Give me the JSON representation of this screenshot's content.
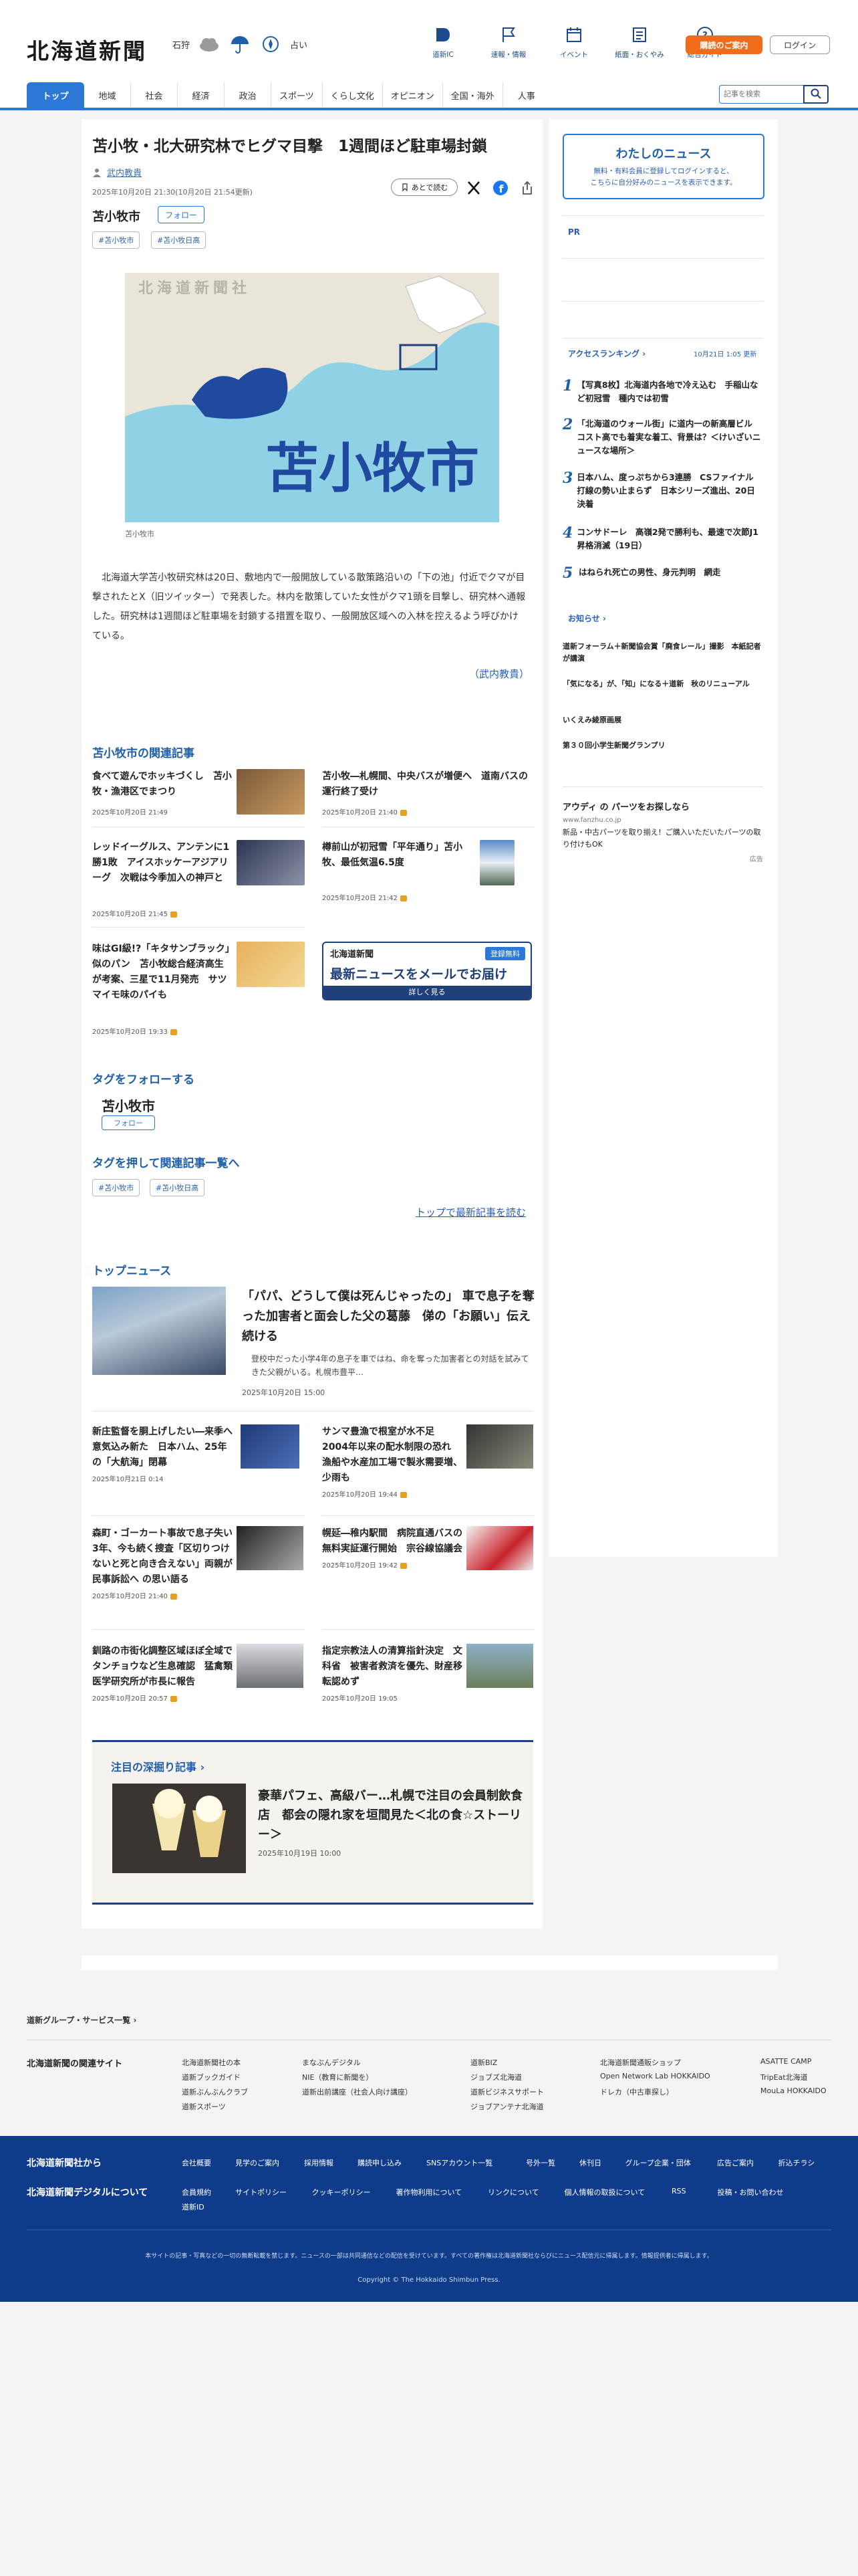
{
  "header": {
    "logo": "北海道新聞",
    "weather_city": "石狩",
    "weather_note": "占い",
    "icons": [
      {
        "label": "道新IC",
        "icon": "book-icon"
      },
      {
        "label": "速報・情報",
        "icon": "flag-icon"
      },
      {
        "label": "イベント",
        "icon": "calendar-icon"
      },
      {
        "label": "紙面・おくやみ",
        "icon": "newspaper-icon"
      },
      {
        "label": "総合ガイド",
        "icon": "help-icon"
      }
    ],
    "subscribe": "購読のご案内",
    "login": "ログイン"
  },
  "nav": {
    "tabs": [
      "トップ",
      "地域",
      "社会",
      "経済",
      "政治",
      "スポーツ",
      "くらし文化",
      "オピニオン",
      "全国・海外",
      "人事"
    ],
    "search_placeholder": "記事を検索"
  },
  "article": {
    "headline": "苫小牧・北大研究林でヒグマ目撃　1週間ほど駐車場封鎖",
    "author": "武内教貴",
    "date": "2025年10月20日 21:30(10月20日 21:54更新)",
    "region": "苫小牧市",
    "follow": "フォロー",
    "save": "あとで読む",
    "tags": [
      "#苫小牧市",
      "#苫小牧日高"
    ],
    "map_watermark": "北海道新聞社",
    "map_label": "苫小牧市",
    "caption": "苫小牧市",
    "body": "北海道大学苫小牧研究林は20日、敷地内で一般開放している散策路沿いの「下の池」付近でクマが目撃されたとX（旧ツイッター）で発表した。林内を散策していた女性がクマ1頭を目撃し、研究林へ通報した。研究林は1週間ほど駐車場を封鎖する措置を取り、一般開放区域への入林を控えるよう呼びかけている。",
    "author_note": "（武内教貴）"
  },
  "related": {
    "title": "苫小牧市の関連記事",
    "items": [
      {
        "title": "食べて遊んでホッキづくし　苫小牧・漁港区でまつり",
        "date": "2025年10月20日 21:49"
      },
      {
        "title": "苫小牧―札幌間、中央バスが増便へ　道南バスの運行終了受け",
        "date": "2025年10月20日 21:40"
      },
      {
        "title": "レッドイーグルス、アンテンに1勝1敗　アイスホッケーアジアリーグ　次戦は今季加入の神戸と",
        "date": "2025年10月20日 21:45"
      },
      {
        "title": "樽前山が初冠雪「平年通り」苫小牧、最低気温6.5度",
        "date": "2025年10月20日 21:42"
      },
      {
        "title": "味はGI級!?「キタサンブラック」似のパン　苫小牧総合経済高生が考案、三星で11月発売　サツマイモ味のパイも",
        "date": "2025年10月20日 19:33"
      }
    ]
  },
  "newsletter": {
    "brand": "北海道新聞",
    "badge": "登録無料",
    "headline": "最新ニュースをメールでお届け",
    "cta": "詳しく見る"
  },
  "tag_follow": {
    "title": "タグをフォローする",
    "tag": "苫小牧市",
    "button": "フォロー"
  },
  "tag_list": {
    "title": "タグを押して関連記事一覧へ",
    "tags": [
      "#苫小牧市",
      "#苫小牧日高"
    ],
    "to_top": "トップで最新記事を読む"
  },
  "top_news": {
    "title": "トップニュース",
    "lead": {
      "title": "「パパ、どうして僕は死んじゃったの」 車で息子を奪った加害者と面会した父の葛藤　俤の「お願い」伝え続ける",
      "lead": "登校中だった小学4年の息子を車ではね、命を奪った加害者との対話を試みてきた父親がいる。札幌市豊平…",
      "date": "2025年10月20日 15:00"
    },
    "items": [
      {
        "title": "新庄監督を胴上げしたい―来季へ意気込み新た　日本ハム、25年の「大航海」閉幕",
        "date": "2025年10月21日 0:14"
      },
      {
        "title": "サンマ豊漁で根室が水不足　2004年以来の配水制限の恐れ　漁船や水産加工場で製氷需要増、少雨も",
        "date": "2025年10月20日 19:44"
      },
      {
        "title": "森町・ゴーカート事故で息子失い3年、今も続く捜査「区切りつけないと死と向き合えない」両親が民事訴訟へ の思い語る",
        "date": "2025年10月20日 21:40"
      },
      {
        "title": "幌延―稚内駅間　病院直通バスの無料実証運行開始　宗谷線協議会",
        "date": "2025年10月20日 19:42"
      },
      {
        "title": "釧路の市街化調整区域ほぼ全域でタンチョウなど生息確認　猛禽類医学研究所が市長に報告",
        "date": "2025年10月20日 20:57"
      },
      {
        "title": "指定宗教法人の清算指針決定　文科省　被害者救済を優先、財産移転認めず",
        "date": "2025年10月20日 19:05"
      }
    ]
  },
  "deepdive": {
    "title": "注目の深掘り記事",
    "story": "豪華パフェ、高級バー…札幌で注目の会員制飲食店　都会の隠れ家を垣間見た＜北の食☆ストーリー＞",
    "date": "2025年10月19日 10:00"
  },
  "sidebar": {
    "mynews_title": "わたしのニュース",
    "mynews_text1": "無料・有料会員に登録してログインすると、",
    "mynews_text2": "こちらに自分好みのニュースを表示できます。",
    "pr": "PR",
    "ranking_title": "アクセスランキング",
    "ranking_time": "10月21日 1:05 更新",
    "ranking": [
      {
        "num": "1",
        "title": "【写真8枚】北海道内各地で冷え込む　手稲山など初冠雪　種内では初雪"
      },
      {
        "num": "2",
        "title": "「北海道のウォール街」に道内一の新高層ビル　コスト高でも着実な着工、背景は？＜けいざいニュースな場所＞"
      },
      {
        "num": "3",
        "title": "日本ハム、度っぷちから3連勝　CSファイナル　打線の勢い止まらず　日本シリーズ進出、20日決着"
      },
      {
        "num": "4",
        "title": "コンサドーレ　高嶺2発で勝利も、最速で次節J1昇格消滅（19日）"
      },
      {
        "num": "5",
        "title": "はねられ死亡の男性、身元判明　網走"
      }
    ],
    "notice_title": "お知らせ",
    "notices": [
      "道新フォーラム＋新聞協会賞「廃食レール」撮影　本紙記者が講演",
      "「気になる」が、「知」になる＋道新　秋のリニューアル",
      "いくえみ綾原画展",
      "第３０回小学生新聞グランプリ"
    ],
    "ad_title": "アウディ の パーツをお探しなら",
    "ad_url": "www.fanzhu.co.jp",
    "ad_text": "新品・中古パーツを取り揃え！ご購入いただいたパーツの取り付けもOK",
    "ad_label": "広告"
  },
  "footer": {
    "group_link": "道新グループ・サービス一覧",
    "related_title": "北海道新聞の関連サイト",
    "sites": [
      [
        "北海道新聞社の本",
        "道新ブックガイド",
        "道新ぶんぶんクラブ",
        "道新スポーツ"
      ],
      [
        "まなぶんデジタル",
        "NIE（教育に新聞を）",
        "道新出前講座（社会人向け講座）"
      ],
      [
        "道新BIZ",
        "ジョブズ北海道",
        "道新ビジネスサポート",
        "ジョブアンテナ北海道"
      ],
      [
        "北海道新聞通販ショップ",
        "Open Network Lab HOKKAIDO",
        "ドレカ（中古車探し）"
      ],
      [
        "ASATTE CAMP",
        "TripEat北海道",
        "MouLa HOKKAIDO"
      ]
    ],
    "from_company": "北海道新聞社から",
    "about_digital": "北海道新聞デジタルについて",
    "links1": [
      "会社概要",
      "見学のご案内",
      "採用情報",
      "購読申し込み",
      "SNSアカウント一覧",
      "号外一覧",
      "休刊日",
      "グループ企業・団体",
      "広告ご案内",
      "折込チラシ"
    ],
    "links2": [
      "会員規約",
      "サイトポリシー",
      "クッキーポリシー",
      "著作物利用について",
      "リンクについて",
      "個人情報の取扱について",
      "RSS",
      "投稿・お問い合わせ",
      "道新ID"
    ],
    "disclaimer": "本サイトの記事・写真などの一切の無断転載を禁じます。ニュースの一部は共同通信などの配信を受けています。すべての著作権は北海道新聞社ならびにニュース配信元に帰属します。情報提供者に帰属します。",
    "copyright": "Copyright © The Hokkaido Shimbun Press."
  },
  "colors": {
    "accent": "#2b78d6",
    "navy": "#0f3c8a",
    "orange": "#ef6c1a"
  }
}
